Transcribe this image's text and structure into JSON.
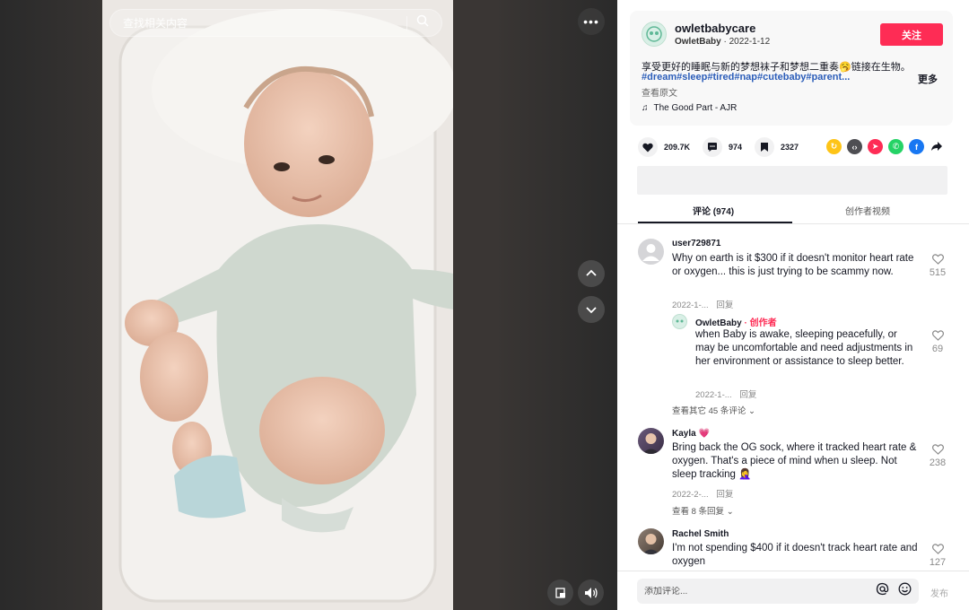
{
  "video": {
    "search_placeholder": "查找相关内容",
    "more_label": "•••"
  },
  "author": {
    "username": "owletbabycare",
    "display_name": "OwletBaby",
    "date": "2022-1-12",
    "follow_label": "关注"
  },
  "post": {
    "description": "享受更好的睡眠与新的梦想袜子和梦想二重奏🥱链接在生物。",
    "tags": "#dream#sleep#tired#nap#cutebaby#parent...",
    "more_label": "更多",
    "see_original": "查看原文",
    "music": "The Good Part - AJR"
  },
  "stats": {
    "likes": "209.7K",
    "comments": "974",
    "saves": "2327"
  },
  "tabs": {
    "comments": "评论 (974)",
    "creator_videos": "创作者视频"
  },
  "comments": [
    {
      "user": "user729871",
      "text": "Why on earth is it $300 if it doesn't monitor heart rate or oxygen... this is just trying to be scammy now.",
      "date": "2022-1-...",
      "reply_label": "回复",
      "likes": "515",
      "reply": {
        "user": "OwletBaby",
        "creator_label": "· 创作者",
        "text": "when Baby is awake, sleeping peacefully, or may be uncomfortable and need adjustments in her environment or assistance to sleep better.",
        "date": "2022-1-...",
        "reply_label": "回复",
        "likes": "69"
      },
      "view_more": "查看其它 45 条评论"
    },
    {
      "user": "Kayla",
      "user_emoji": "💗",
      "text": "Bring back the OG sock, where it tracked heart rate & oxygen. That's a piece of mind when u sleep. Not sleep tracking 🤦‍♀️",
      "date": "2022-2-...",
      "reply_label": "回复",
      "likes": "238",
      "view_more": "查看 8 条回复"
    },
    {
      "user": "Rachel Smith",
      "text": "I'm not spending $400 if it doesn't track heart rate and oxygen",
      "likes": "127"
    }
  ],
  "composer": {
    "placeholder": "添加评论...",
    "post_label": "发布"
  },
  "colors": {
    "accent": "#fe2c55",
    "tag_blue": "#2b5db9"
  }
}
